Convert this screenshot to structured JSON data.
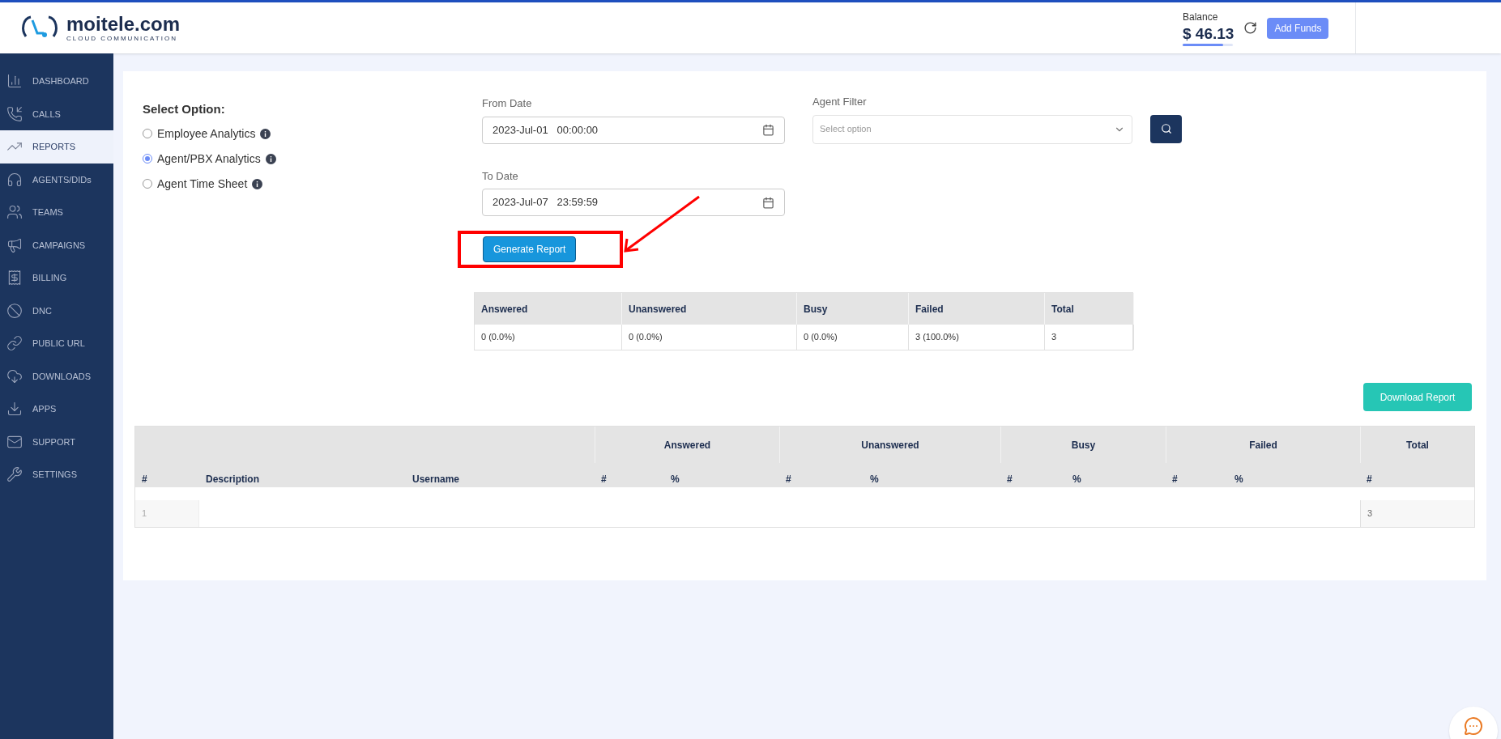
{
  "header": {
    "logo_name": "moitele.com",
    "logo_tagline": "CLOUD COMMUNICATION",
    "balance_label": "Balance",
    "balance_value": "$ 46.13",
    "balance_bar": {
      "level": 0.8
    },
    "add_funds": "Add Funds"
  },
  "sidebar": {
    "items": [
      {
        "label": "DASHBOARD",
        "selected": false
      },
      {
        "label": "CALLS",
        "selected": false
      },
      {
        "label": "REPORTS",
        "selected": true
      },
      {
        "label": "AGENTS/DIDs",
        "selected": false
      },
      {
        "label": "TEAMS",
        "selected": false
      },
      {
        "label": "CAMPAIGNS",
        "selected": false
      },
      {
        "label": "BILLING",
        "selected": false
      },
      {
        "label": "DNC",
        "selected": false
      },
      {
        "label": "PUBLIC URL",
        "selected": false
      },
      {
        "label": "DOWNLOADS",
        "selected": false
      },
      {
        "label": "APPS",
        "selected": false
      },
      {
        "label": "SUPPORT",
        "selected": false
      },
      {
        "label": "SETTINGS",
        "selected": false
      }
    ]
  },
  "options": {
    "title": "Select Option:",
    "items": [
      {
        "label": "Employee Analytics",
        "selected": false
      },
      {
        "label": "Agent/PBX Analytics",
        "selected": true
      },
      {
        "label": "Agent Time Sheet",
        "selected": false
      }
    ]
  },
  "from_date": {
    "label": "From Date",
    "value": "2023-Jul-01   00:00:00"
  },
  "to_date": {
    "label": "To Date",
    "value": "2023-Jul-07   23:59:59"
  },
  "agent_filter": {
    "label": "Agent Filter",
    "placeholder": "Select option"
  },
  "generate_button": "Generate Report",
  "summary": {
    "columns": [
      "Answered",
      "Unanswered",
      "Busy",
      "Failed",
      "Total"
    ],
    "values": [
      "0 (0.0%)",
      "0 (0.0%)",
      "0 (0.0%)",
      "3 (100.0%)",
      "3"
    ]
  },
  "download_button": "Download Report",
  "report_table": {
    "groups": [
      "Answered",
      "Unanswered",
      "Busy",
      "Failed",
      "Total"
    ],
    "columns": [
      "#",
      "Description",
      "Username",
      "#",
      "%",
      "#",
      "%",
      "#",
      "%",
      "#",
      "%",
      "#"
    ],
    "rows": [
      {
        "number": "1",
        "total_count": "3"
      }
    ]
  }
}
